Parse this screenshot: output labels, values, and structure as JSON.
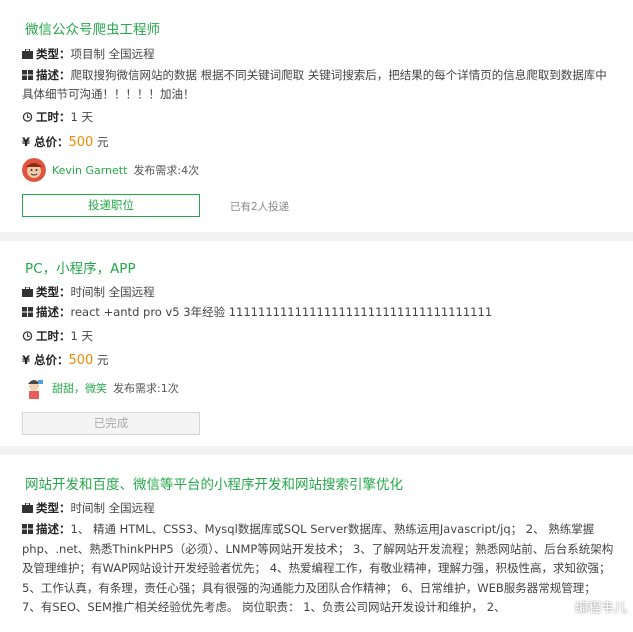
{
  "colors": {
    "accent": "#25a849",
    "price": "#f08a00",
    "background": "#f1f1f1"
  },
  "labels": {
    "type": "类型：",
    "desc": "描述：",
    "hours": "工时：",
    "total": "总价：",
    "posted_prefix": "发布需求:"
  },
  "jobs": [
    {
      "title": "微信公众号爬虫工程师",
      "type_value": "项目制 全国远程",
      "desc_value": "爬取搜狗微信网站的数据 根据不同关键词爬取 关键词搜索后，把结果的每个详情页的信息爬取到数据库中 具体细节可沟通！！！！！加油！",
      "hours_value": "1 天",
      "price_value": "500",
      "price_unit": "元",
      "user_name": "Kevin Garnett",
      "posted_text": "发布需求:4次",
      "button_label": "投递职位",
      "bid_count": "已有2人投递"
    },
    {
      "title": "PC，小程序，APP",
      "type_value": "时间制 全国远程",
      "desc_value": "react +antd pro v5 3年经验 111111111111111111111111111111111111",
      "hours_value": "1 天",
      "price_value": "500",
      "price_unit": "元",
      "user_name": "甜甜，微笑",
      "posted_text": "发布需求:1次",
      "button_label": "已完成"
    },
    {
      "title": "网站开发和百度、微信等平台的小程序开发和网站搜索引擎优化",
      "type_value": "时间制 全国远程",
      "desc_value": "1、 精通 HTML、CSS3、Mysql数据库或SQL Server数据库、熟练运用Javascript/jq； 2、 熟练掌握php、.net、熟悉ThinkPHP5（必须）、LNMP等网站开发技术； 3、了解网站开发流程；熟悉网站前、后台系统架构及管理维护；有WAP网站设计开发经验者优先； 4、热爱编程工作，有敬业精神，理解力强，积极性高，求知欲强； 5、工作认真，有条理，责任心强；具有很强的沟通能力及团队合作精神； 6、日常维护，WEB服务器常规管理； 7、有SEO、SEM推广相关经验优先考虑。 岗位职责： 1、负责公司网站开发设计和维护， 2、"
    }
  ],
  "watermark": {
    "icon": "wechat-icon",
    "text": "编程韦儿"
  }
}
